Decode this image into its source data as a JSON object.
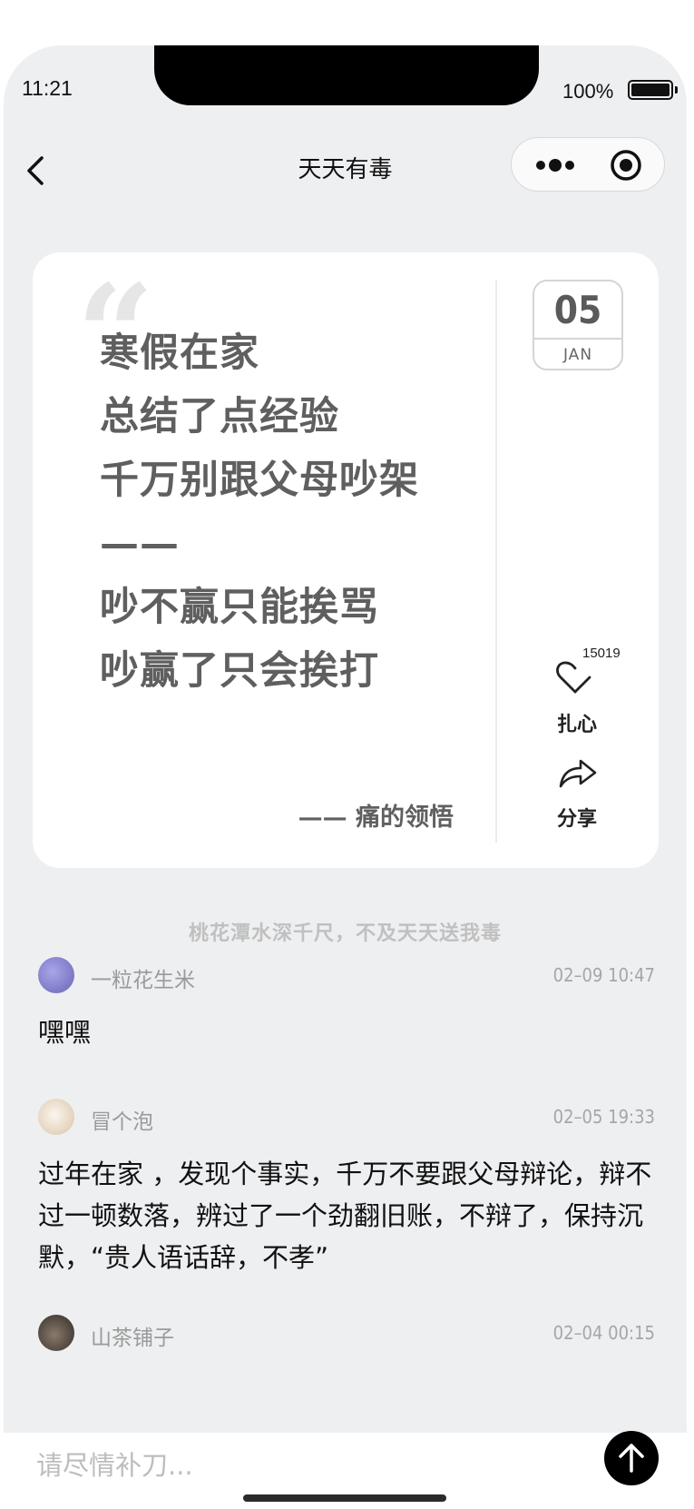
{
  "status_bar": {
    "time": "11:21",
    "battery": "100%"
  },
  "nav": {
    "title": "天天有毒"
  },
  "card": {
    "lines": [
      "寒假在家",
      "总结了点经验",
      "千万别跟父母吵架",
      "——",
      "吵不赢只能挨骂",
      "吵赢了只会挨打"
    ],
    "attribution": "—— 痛的领悟",
    "date": {
      "day": "05",
      "month": "JAN"
    },
    "like": {
      "count": "15019",
      "label": "扎心"
    },
    "share": {
      "label": "分享"
    }
  },
  "motto": "桃花潭水深千尺，不及天天送我毒",
  "comments": [
    {
      "name": "一粒花生米",
      "time": "02–09 10:47",
      "text": "嘿嘿"
    },
    {
      "name": "冒个泡",
      "time": "02–05 19:33",
      "text": "过年在家 ，发现个事实，千万不要跟父母辩论，辩不过一顿数落，辨过了一个劲翻旧账，不辩了，保持沉默，“贵人语话辞，不孝”"
    },
    {
      "name": "山茶铺子",
      "time": "02–04 00:15",
      "text": ""
    }
  ],
  "input": {
    "placeholder": "请尽情补刀..."
  }
}
